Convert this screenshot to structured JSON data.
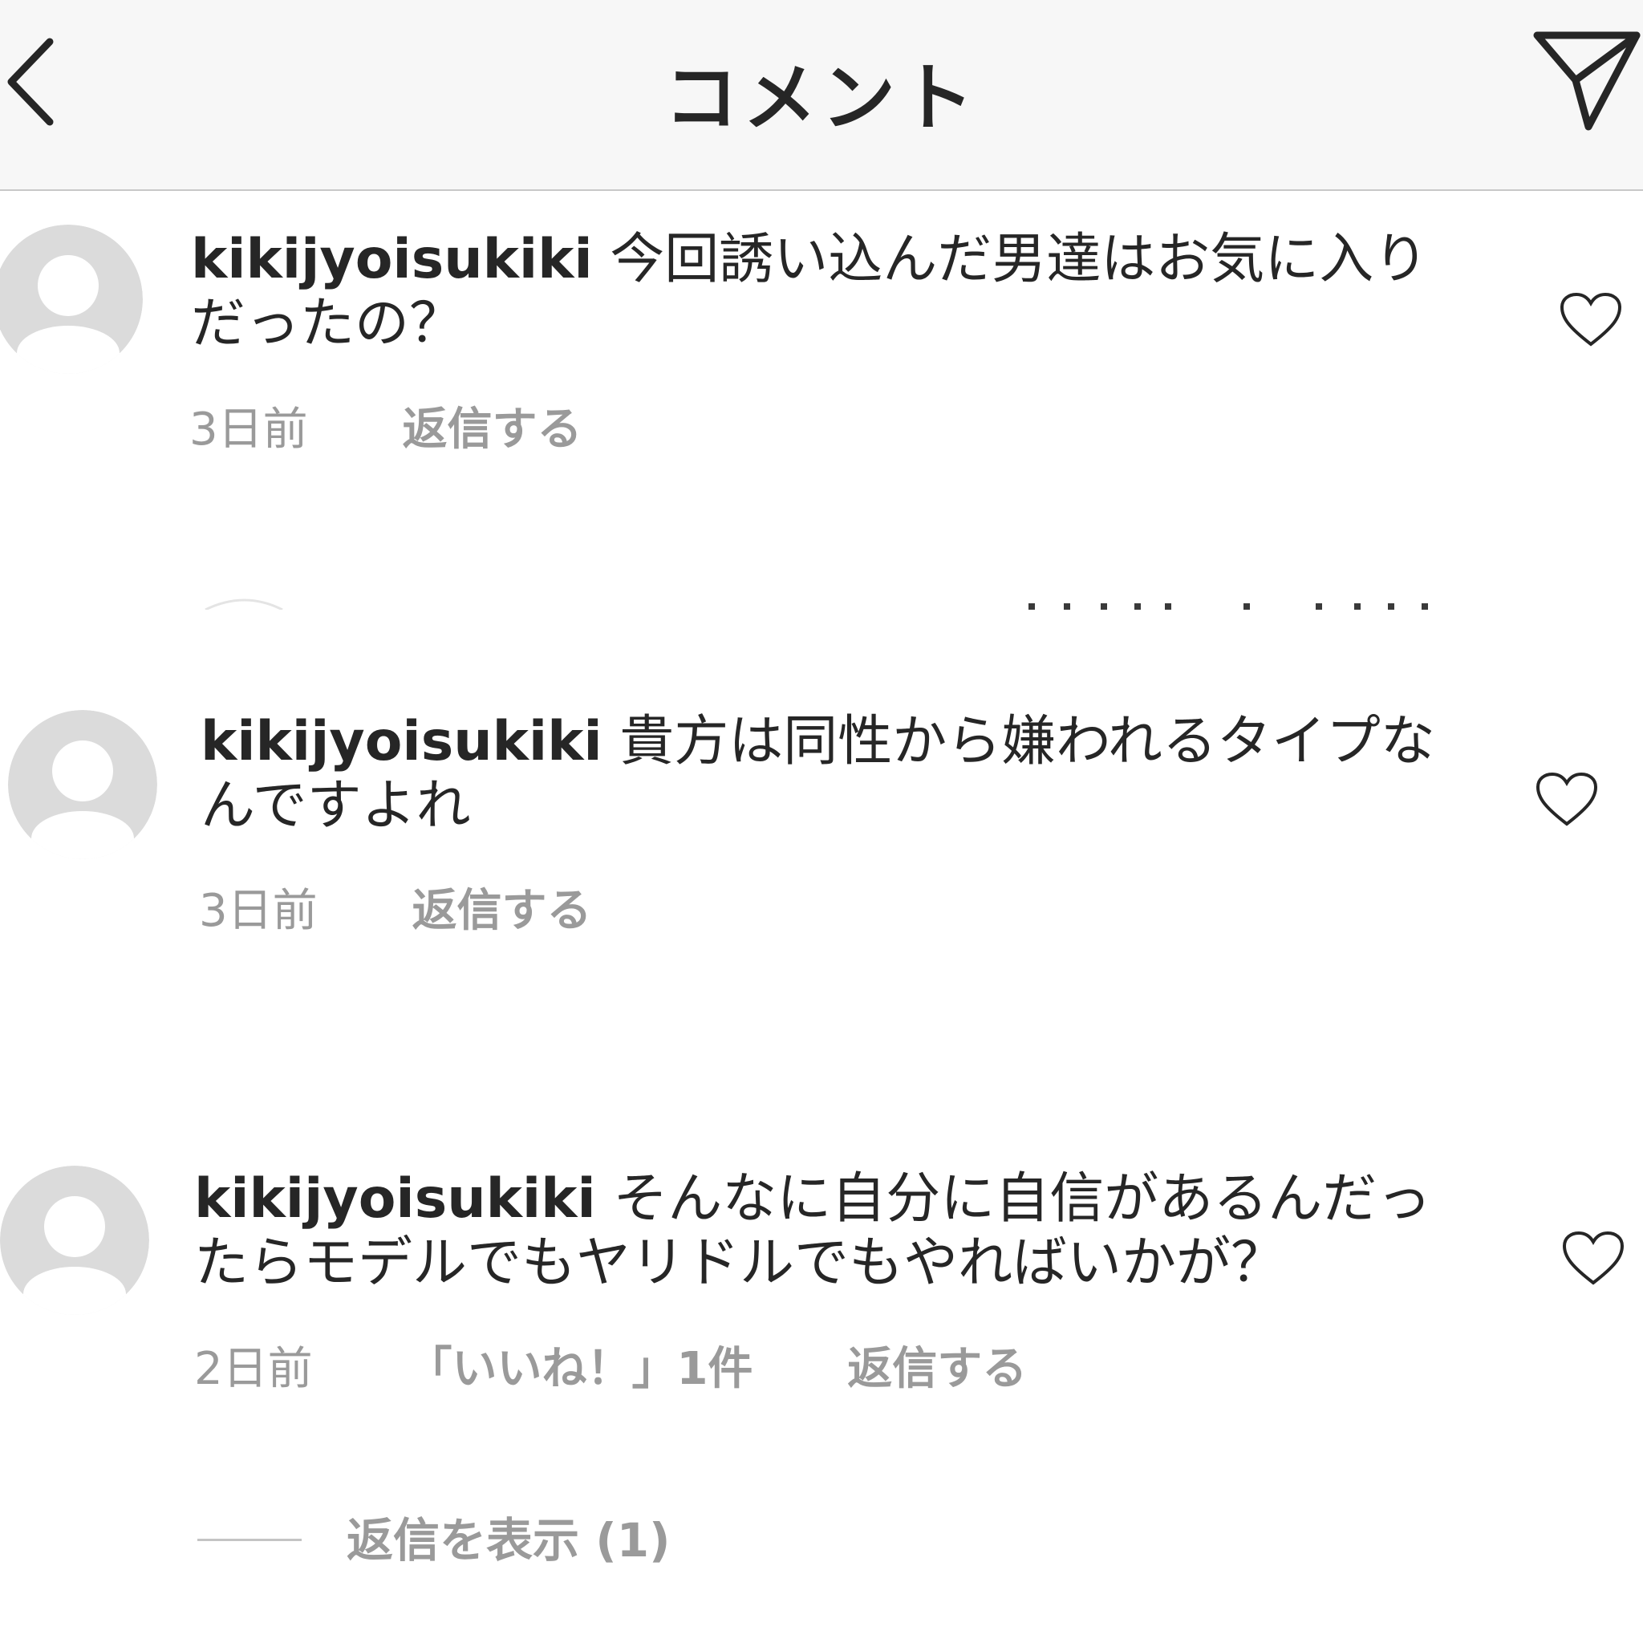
{
  "header": {
    "title": "コメント",
    "back_icon": "chevron-left-icon",
    "share_icon": "paper-plane-icon"
  },
  "comments": [
    {
      "username": "kikijyoisukiki",
      "text": "今回誘い込んだ男達はお気に入りだったの？",
      "time": "3日前",
      "reply_label": "返信する"
    },
    {
      "username": "kikijyoisukiki",
      "text": "貴方は同性から嫌われるタイプなんですよれ",
      "time": "3日前",
      "reply_label": "返信する"
    },
    {
      "username": "kikijyoisukiki",
      "text": "そんなに自分に自信があるんだったらモデルでもヤリドルでもやればいかが？",
      "time": "2日前",
      "likes_label": "「いいね！」1件",
      "reply_label": "返信する",
      "view_replies_label": "返信を表示 (1)"
    }
  ],
  "colors": {
    "header_bg": "#f7f7f7",
    "text": "#262626",
    "meta_text": "#9a9a9a",
    "avatar_bg": "#dbdbdb",
    "divider": "#c8c8c8"
  }
}
